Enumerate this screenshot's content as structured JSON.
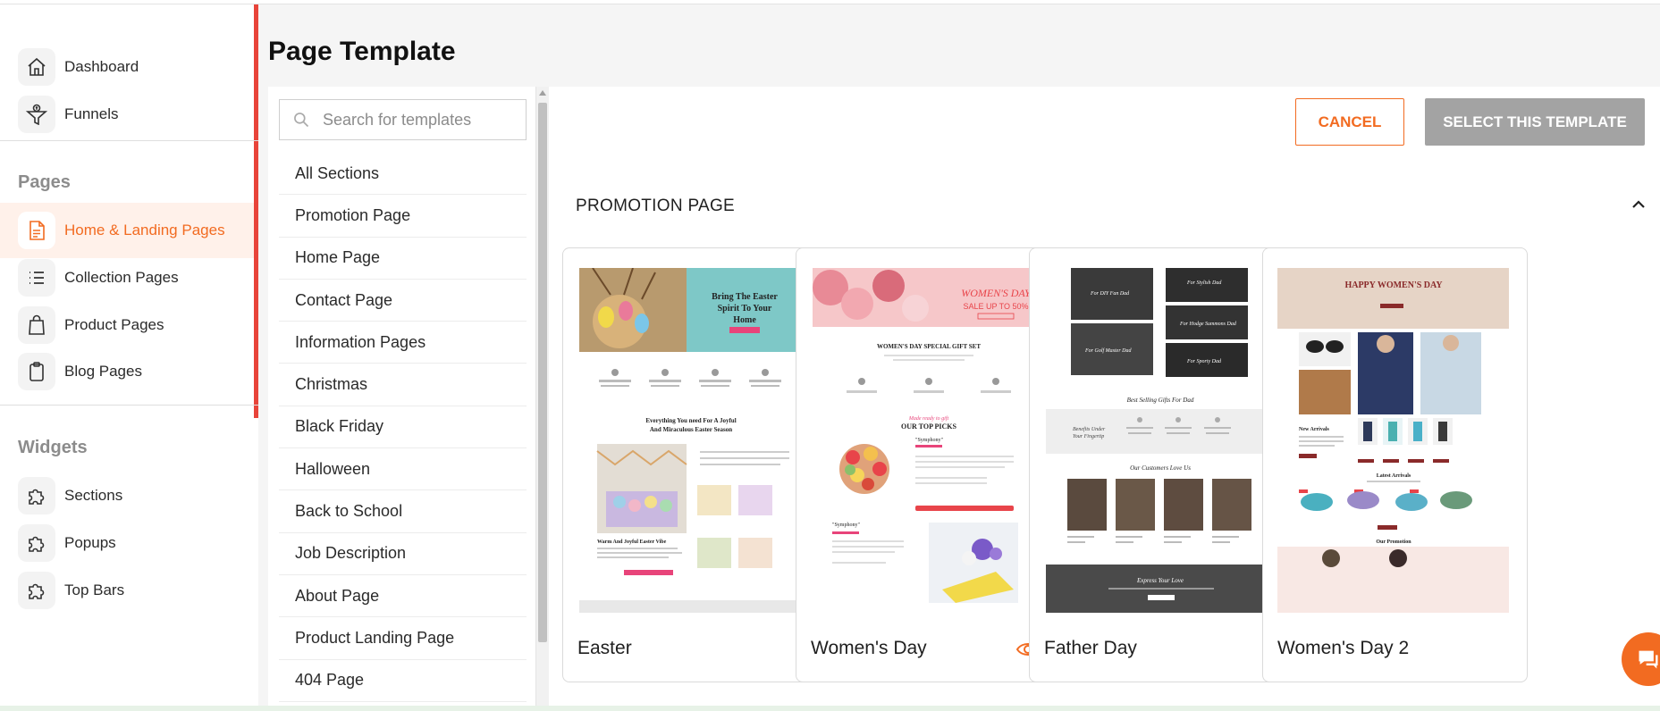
{
  "sidebar": {
    "top_items": [
      {
        "label": "Dashboard",
        "icon": "home-icon"
      },
      {
        "label": "Funnels",
        "icon": "funnel-icon"
      }
    ],
    "pages_heading": "Pages",
    "pages_items": [
      {
        "label": "Home & Landing Pages",
        "icon": "page-icon",
        "active": true
      },
      {
        "label": "Collection Pages",
        "icon": "list-icon"
      },
      {
        "label": "Product Pages",
        "icon": "shopping-bag-icon"
      },
      {
        "label": "Blog Pages",
        "icon": "clipboard-icon"
      }
    ],
    "widgets_heading": "Widgets",
    "widgets_items": [
      {
        "label": "Sections",
        "icon": "puzzle-icon"
      },
      {
        "label": "Popups",
        "icon": "puzzle-icon"
      },
      {
        "label": "Top Bars",
        "icon": "puzzle-icon"
      }
    ]
  },
  "main": {
    "title": "Page Template",
    "search": {
      "placeholder": "Search for templates",
      "value": ""
    },
    "categories": [
      "All Sections",
      "Promotion Page",
      "Home Page",
      "Contact Page",
      "Information Pages",
      "Christmas",
      "Black Friday",
      "Halloween",
      "Back to School",
      "Job Description",
      "About Page",
      "Product Landing Page",
      "404 Page"
    ],
    "cancel_label": "CANCEL",
    "select_label": "SELECT THIS TEMPLATE",
    "section_title": "PROMOTION PAGE",
    "templates": [
      {
        "name": "Easter",
        "hero_title": "Bring The Easter Spirit To Your Home",
        "sub_title": "Everything You need For A Joyful And Miraculous Easter Season",
        "product_title": "Warm And Joyful Easter Vibe"
      },
      {
        "name": "Women's Day",
        "hero_title": "WOMEN'S DAY",
        "hero_sub": "SALE UP TO 50%",
        "gift_title": "WOMEN'S DAY SPECIAL GIFT SET",
        "picks_title": "OUR TOP PICKS",
        "product_name": "\"Symphony\""
      },
      {
        "name": "Father Day",
        "tiles": [
          "For DIY Fan Dad",
          "For Stylish Dad",
          "For Golf Master Dad",
          "For Hodge Summons Dad",
          "For Sporty Dad"
        ],
        "best_selling": "Best Selling Gifts For Dad",
        "love": "Our Customers Love Us",
        "express": "Express Your Love"
      },
      {
        "name": "Women's Day 2",
        "hero_title": "HAPPY WOMEN'S DAY",
        "new_arrivals": "New Arrivals",
        "latest": "Latest Arrivals",
        "promotion": "Our Promotion"
      }
    ]
  },
  "colors": {
    "accent": "#f26b21",
    "sidebar_accent": "#e8443a",
    "active_bg": "#fff1ea",
    "select_disabled": "#a3a3a3"
  }
}
